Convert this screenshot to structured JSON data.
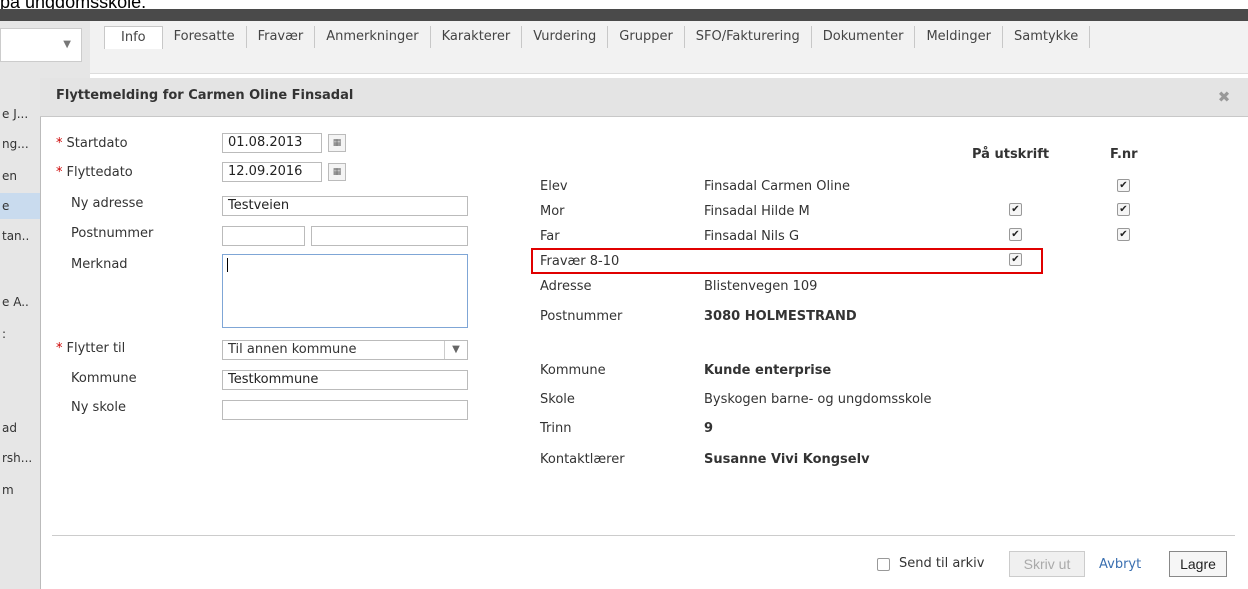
{
  "caption": "på ungdomsskole.",
  "left_panel": {
    "items": [
      "e J...",
      "ng...",
      "en",
      "e",
      "tan..",
      "e A..",
      ":",
      "ad",
      "rsh...",
      "m"
    ]
  },
  "tabs": [
    "Info",
    "Foresatte",
    "Fravær",
    "Anmerkninger",
    "Karakterer",
    "Vurdering",
    "Grupper",
    "SFO/Fakturering",
    "Dokumenter",
    "Meldinger",
    "Samtykke"
  ],
  "active_tab": "Info",
  "dialog": {
    "title": "Flyttemelding for Carmen Oline Finsadal",
    "close_icon": "close-icon"
  },
  "form": {
    "startdato_label": "Startdato",
    "startdato_value": "01.08.2013",
    "flyttedato_label": "Flyttedato",
    "flyttedato_value": "12.09.2016",
    "ny_adresse_label": "Ny adresse",
    "ny_adresse_value": "Testveien",
    "postnummer_label": "Postnummer",
    "postnummer_value": "",
    "poststed_value": "",
    "merknad_label": "Merknad",
    "merknad_value": "",
    "flytter_til_label": "Flytter til",
    "flytter_til_value": "Til annen kommune",
    "kommune_label": "Kommune",
    "kommune_value": "Testkommune",
    "ny_skole_label": "Ny skole",
    "ny_skole_value": "",
    "required_marker": "*"
  },
  "info": {
    "col_utskrift": "På utskrift",
    "col_fnr": "F.nr",
    "rows": [
      {
        "label": "Elev",
        "value": "Finsadal Carmen Oline",
        "bold": false,
        "utskrift": null,
        "fnr": true
      },
      {
        "label": "Mor",
        "value": "Finsadal Hilde M",
        "bold": false,
        "utskrift": true,
        "fnr": true
      },
      {
        "label": "Far",
        "value": "Finsadal Nils G",
        "bold": false,
        "utskrift": true,
        "fnr": true
      },
      {
        "label": "Fravær 8-10",
        "value": "",
        "bold": false,
        "utskrift": true,
        "fnr": null
      },
      {
        "label": "Adresse",
        "value": "Blistenvegen 109",
        "bold": false,
        "utskrift": null,
        "fnr": null
      },
      {
        "label": "Postnummer",
        "value": "3080 HOLMESTRAND",
        "bold": true,
        "utskrift": null,
        "fnr": null
      },
      {
        "label": "Kommune",
        "value": "Kunde enterprise",
        "bold": true,
        "utskrift": null,
        "fnr": null
      },
      {
        "label": "Skole",
        "value": "Byskogen barne- og ungdomsskole",
        "bold": false,
        "utskrift": null,
        "fnr": null
      },
      {
        "label": "Trinn",
        "value": "9",
        "bold": true,
        "utskrift": null,
        "fnr": null
      },
      {
        "label": "Kontaktlærer",
        "value": "Susanne Vivi Kongselv",
        "bold": true,
        "utskrift": null,
        "fnr": null
      }
    ],
    "highlight_color": "#e00000"
  },
  "footer": {
    "send_arkiv_label": "Send til arkiv",
    "print_label": "Skriv ut",
    "cancel_label": "Avbryt",
    "save_label": "Lagre"
  },
  "colors": {
    "accent_link": "#3a6fb0",
    "required": "#cc0000"
  }
}
